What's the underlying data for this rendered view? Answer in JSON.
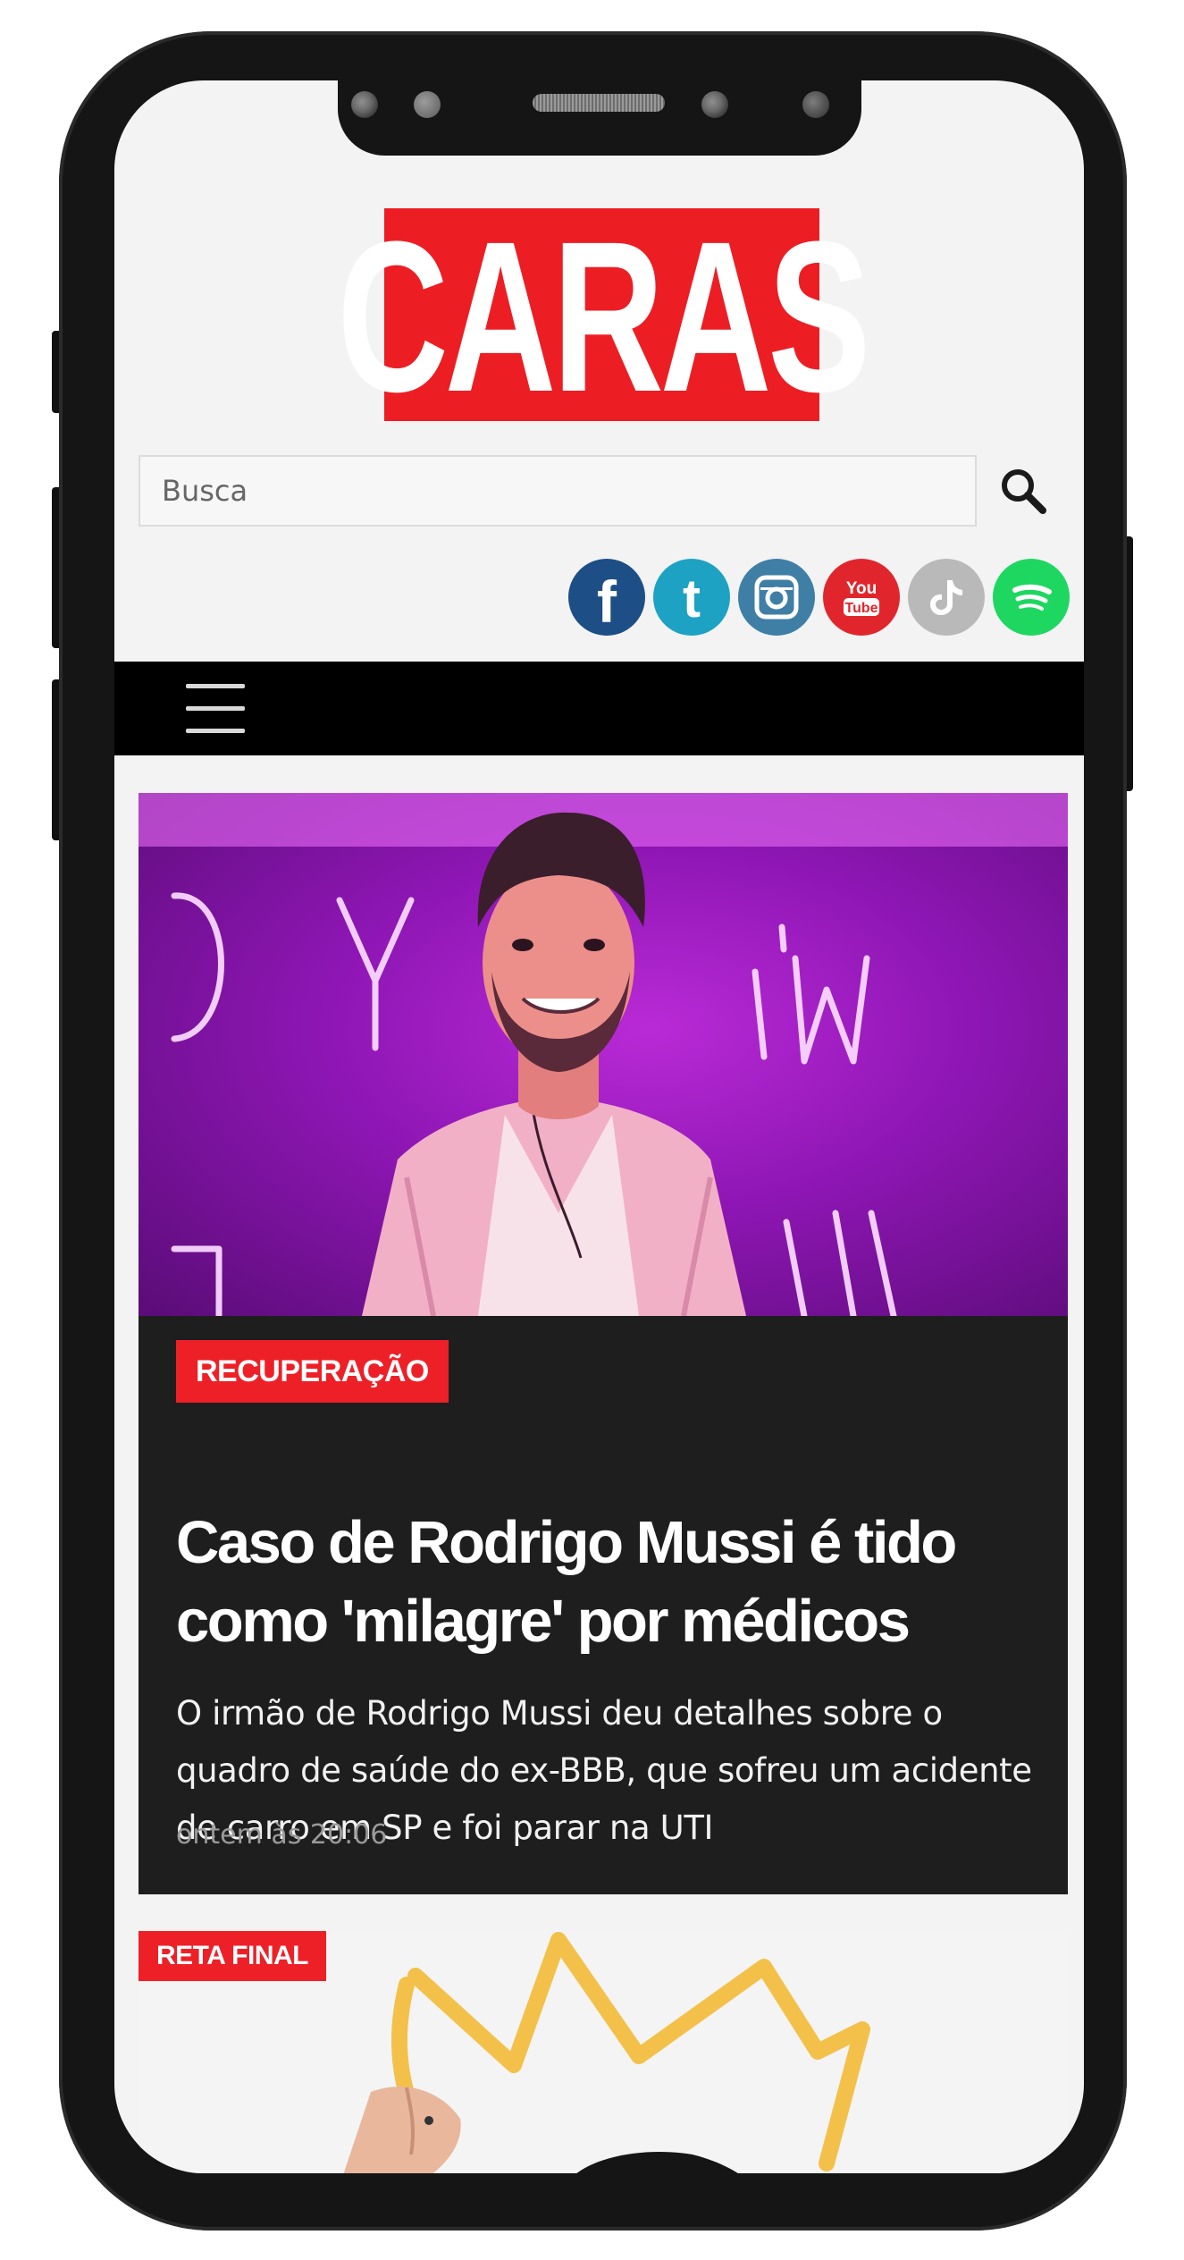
{
  "header": {
    "logo_text": "CARAS"
  },
  "search": {
    "placeholder": "Busca"
  },
  "social": [
    {
      "name": "facebook-icon",
      "glyph": "f",
      "color": "#1d4f86"
    },
    {
      "name": "twitter-icon",
      "glyph": "t",
      "color": "#1ea2c3"
    },
    {
      "name": "instagram-icon",
      "glyph": "",
      "color": "#3f7fa6"
    },
    {
      "name": "youtube-icon",
      "glyph": "You\nTube",
      "color": "#e0262c"
    },
    {
      "name": "tiktok-icon",
      "glyph": "♪",
      "color": "#b9b9b9"
    },
    {
      "name": "spotify-icon",
      "glyph": "",
      "color": "#1ed760"
    }
  ],
  "feature": {
    "category": "RECUPERAÇÃO",
    "title": "Caso de Rodrigo Mussi é tido como 'milagre' por médicos",
    "summary": "O irmão de Rodrigo Mussi deu detalhes sobre o quadro de saúde do ex-BBB, que sofreu um acidente de carro em SP e foi parar na UTI",
    "time": "ontem às 20:06"
  },
  "second": {
    "category": "RETA FINAL"
  },
  "colors": {
    "brand_red": "#ec1e24",
    "nav_black": "#000000",
    "card_dark": "#1e1e1f"
  }
}
